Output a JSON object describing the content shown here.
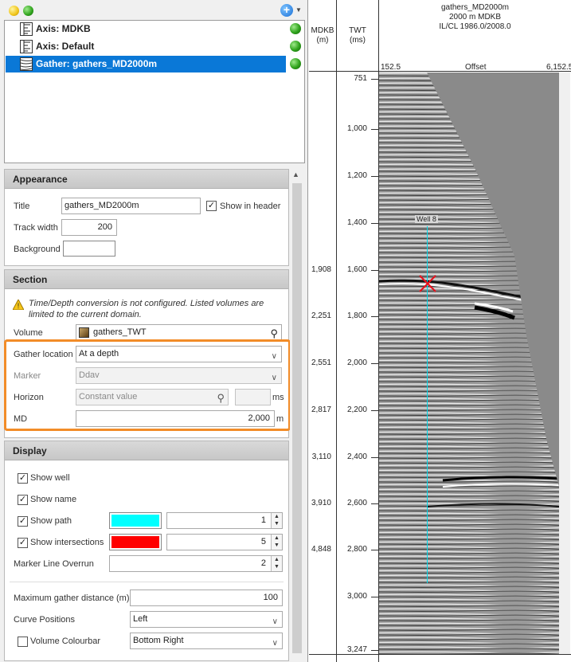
{
  "tree": {
    "items": [
      {
        "label": "Axis: MDKB",
        "icon": "axis-icon"
      },
      {
        "label": "Axis: Default",
        "icon": "axis-icon"
      },
      {
        "label": "Gather: gathers_MD2000m",
        "icon": "gather-icon",
        "selected": true
      }
    ]
  },
  "appearance": {
    "header": "Appearance",
    "title_label": "Title",
    "title_value": "gathers_MD2000m",
    "show_in_header_label": "Show in header",
    "show_in_header": true,
    "track_width_label": "Track width",
    "track_width_value": "200",
    "background_label": "Background"
  },
  "section": {
    "header": "Section",
    "warning": "Time/Depth conversion is not configured. Listed volumes are limited to the current domain.",
    "volume_label": "Volume",
    "volume_value": "gathers_TWT",
    "gather_location_label": "Gather location",
    "gather_location_value": "At a depth",
    "marker_label": "Marker",
    "marker_value": "Ddav",
    "horizon_label": "Horizon",
    "horizon_placeholder": "Constant value",
    "horizon_unit": "ms",
    "md_label": "MD",
    "md_value": "2,000",
    "md_unit": "m"
  },
  "display": {
    "header": "Display",
    "show_well_label": "Show well",
    "show_name_label": "Show name",
    "show_path_label": "Show path",
    "show_path_value": "1",
    "path_color": "#00ffff",
    "show_intersections_label": "Show intersections",
    "show_intersections_value": "5",
    "intersections_color": "#ff0000",
    "marker_overrun_label": "Marker Line Overrun",
    "marker_overrun_value": "2",
    "max_gather_distance_label": "Maximum gather distance (m)",
    "max_gather_distance_value": "100",
    "curve_positions_label": "Curve Positions",
    "curve_positions_value": "Left",
    "volume_colourbar_label": "Volume Colourbar",
    "volume_colourbar_value": "Bottom Right"
  },
  "track": {
    "mdkb_header": "MDKB\n(m)",
    "mdkb_title": "MDKB",
    "mdkb_unit": "(m)",
    "twt_title": "TWT",
    "twt_unit": "(ms)",
    "gather_title": "gathers_MD2000m",
    "gather_sub1": "2000 m MDKB",
    "gather_sub2": "IL/CL 1986.0/2008.0",
    "offset_min": "152.5",
    "offset_label": "Offset",
    "offset_max": "6,152.5",
    "well_label": "Well 8",
    "twt_ticks": [
      "751",
      "1,000",
      "1,200",
      "1,400",
      "1,600",
      "1,800",
      "2,000",
      "2,200",
      "2,400",
      "2,600",
      "2,800",
      "3,000",
      "3,247"
    ],
    "mdkb_ticks": [
      "1,908",
      "2,251",
      "2,551",
      "2,817",
      "3,110",
      "3,910",
      "4,848"
    ]
  },
  "colors": {
    "selection": "#0a78d7",
    "highlight_box": "#f28c28",
    "well_path": "#00d8e8",
    "intersection": "#e8101c"
  }
}
